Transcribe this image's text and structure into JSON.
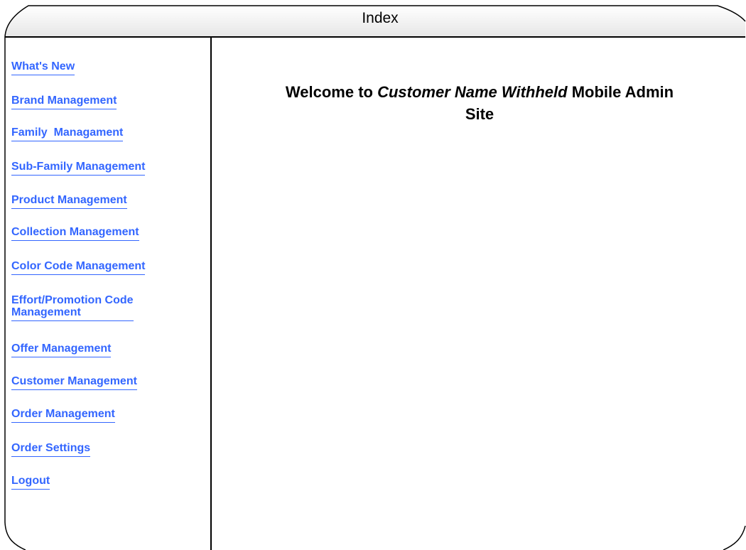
{
  "window": {
    "title": "Index"
  },
  "sidebar": {
    "links": [
      {
        "label": "What's New"
      },
      {
        "label": "Brand Management"
      },
      {
        "label": "Family  Managament"
      },
      {
        "label": "Sub-Family Management"
      },
      {
        "label": "Product Management"
      },
      {
        "label": "Collection Management"
      },
      {
        "label": "Color Code Management"
      },
      {
        "label_line1": "Effort/Promotion Code",
        "label_line2": "Management"
      },
      {
        "label": "Offer Management"
      },
      {
        "label": "Customer Management"
      },
      {
        "label": "Order Management"
      },
      {
        "label": "Order Settings"
      },
      {
        "label": "Logout"
      }
    ]
  },
  "main": {
    "welcome_prefix": "Welcome to ",
    "customer_name": "Customer Name Withheld",
    "welcome_suffix": " Mobile Admin",
    "welcome_line2": "Site"
  },
  "colors": {
    "link": "#3366ff",
    "text": "#000000",
    "frame_line": "#000000",
    "title_bar": "#f2f2f2"
  }
}
